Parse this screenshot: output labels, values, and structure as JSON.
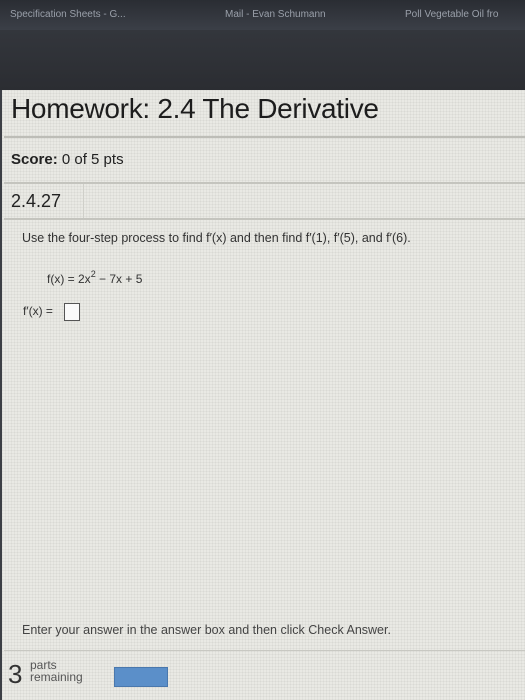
{
  "browser": {
    "tabs": [
      "Specification Sheets - G...",
      "Mail - Evan Schumann",
      "Poll Vegetable Oil fro"
    ]
  },
  "homework": {
    "title": "Homework: 2.4 The Derivative",
    "score_label": "Score:",
    "score_value": "0 of 5 pts"
  },
  "question": {
    "number": "2.4.27",
    "prompt": "Use the four-step process to find f′(x) and then find f′(1), f′(5), and f′(6).",
    "function_left": "f(x) = 2x",
    "function_exp": "2",
    "function_right": " − 7x + 5",
    "answer_label": "f′(x) ="
  },
  "footer": {
    "instruction": "Enter your answer in the answer box and then click Check Answer.",
    "parts_count": "3",
    "parts_label_1": "parts",
    "parts_label_2": "remaining"
  }
}
